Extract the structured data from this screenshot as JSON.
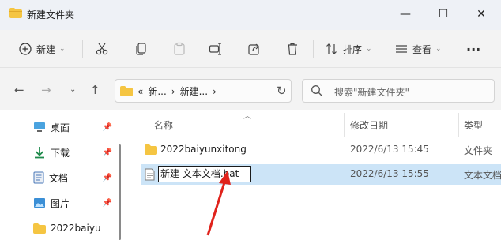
{
  "window": {
    "title": "新建文件夹",
    "controls": {
      "minimize": "—",
      "maximize": "☐",
      "close": "✕"
    }
  },
  "toolbar": {
    "new_label": "新建",
    "sort_label": "排序",
    "view_label": "查看",
    "more_label": "···"
  },
  "address": {
    "prefix": "«",
    "crumbs": [
      "新...",
      "新建..."
    ],
    "separator": "›"
  },
  "search": {
    "placeholder": "搜索\"新建文件夹\""
  },
  "sidebar": {
    "items": [
      {
        "label": "桌面",
        "icon": "desktop-icon"
      },
      {
        "label": "下载",
        "icon": "download-icon"
      },
      {
        "label": "文档",
        "icon": "document-icon"
      },
      {
        "label": "图片",
        "icon": "picture-icon"
      },
      {
        "label": "2022baiyun",
        "icon": "folder-icon"
      }
    ]
  },
  "columns": {
    "name": "名称",
    "modified": "修改日期",
    "type": "类型"
  },
  "files": [
    {
      "name": "2022baiyunxitong",
      "modified": "2022/6/13 15:45",
      "type": "文件夹",
      "icon": "folder-icon"
    },
    {
      "name": "新建 文本文档.bat",
      "modified": "2022/6/13 15:55",
      "type": "文本文档",
      "icon": "text-file-icon"
    }
  ],
  "colors": {
    "selection": "#cce4f7",
    "folder": "#f5c542",
    "annotation_arrow": "#e0221b"
  }
}
